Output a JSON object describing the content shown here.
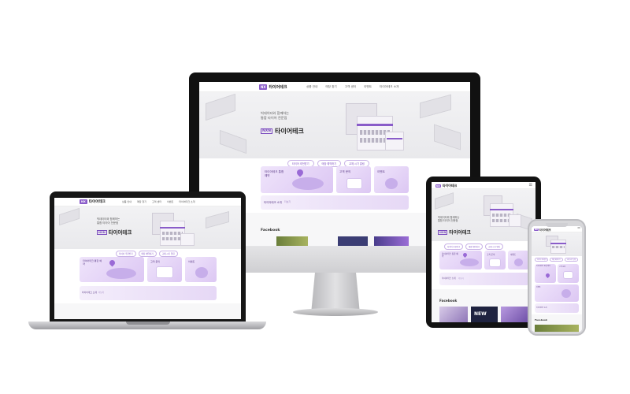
{
  "site": {
    "logo_badge": "NX",
    "logo_text": "타이어테크",
    "nav": [
      "상품 안내",
      "매장 찾기",
      "고객 센터",
      "이벤트",
      "타이어테크 소개"
    ],
    "hero_line1": "빅데이터와 함께하는",
    "hero_line2": "통합 타이어 전문점",
    "hero_logo_mark": "NXN",
    "hero_brand": "타이어테크",
    "quick_links": [
      "타이어 추천받기",
      "매장 예약하기",
      "교체 시기 알림"
    ],
    "cards": {
      "reserve": "타이어테크 통합 예약",
      "center": "고객 문의",
      "event": "이벤트"
    },
    "intro": "타이어테크 소개",
    "intro_more": "더보기",
    "facebook": "Facebook",
    "news_tag": "NEW"
  },
  "colors": {
    "accent": "#8a5cc9",
    "accent_light": "#e4d3f6",
    "frame_dark": "#111111",
    "metal": "#c9c9cc"
  },
  "icons": [
    "pin-icon",
    "speech-bubble-icon",
    "gift-icon",
    "car-icon",
    "menu-icon"
  ]
}
